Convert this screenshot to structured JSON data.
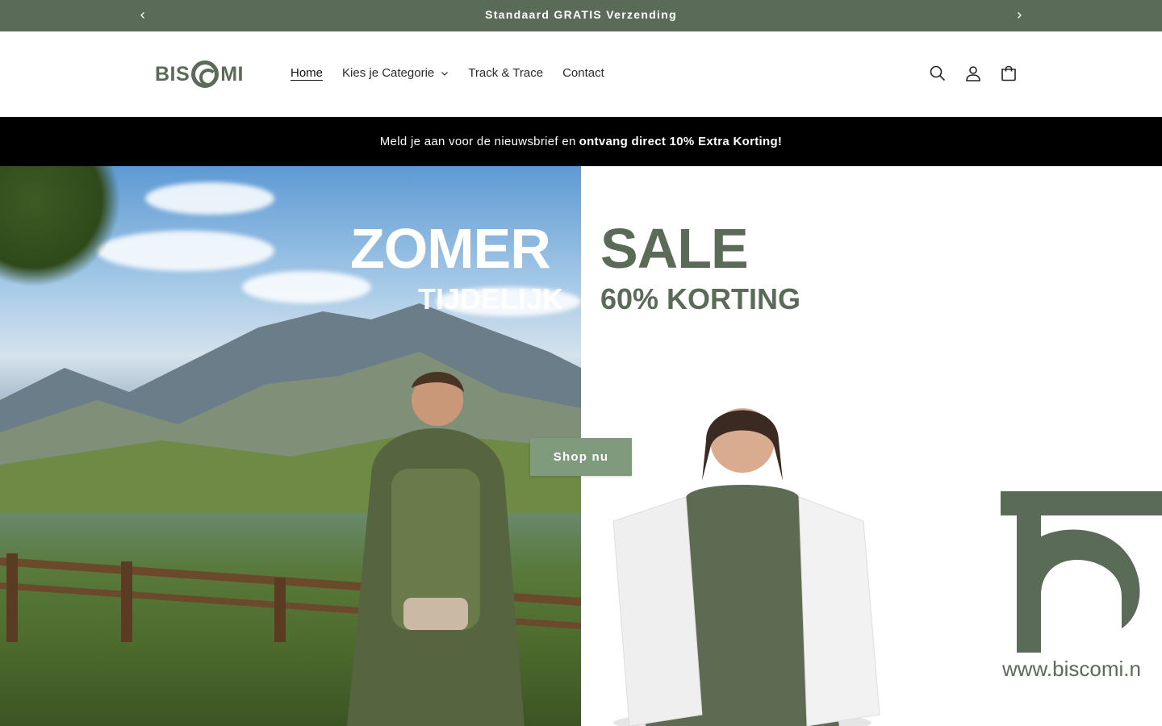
{
  "announcement": {
    "text": "Standaard GRATIS Verzending",
    "prev_icon": "chevron-left-icon",
    "next_icon": "chevron-right-icon"
  },
  "header": {
    "logo_left": "BIS",
    "logo_right": "MI",
    "nav": [
      {
        "label": "Home",
        "active": true
      },
      {
        "label": "Kies je Categorie",
        "has_dropdown": true
      },
      {
        "label": "Track & Trace"
      },
      {
        "label": "Contact"
      }
    ],
    "icons": [
      "search-icon",
      "account-icon",
      "cart-icon"
    ]
  },
  "promo": {
    "text": "Meld je aan voor de nieuwsbrief en",
    "bold": "ontvang direct 10% Extra Korting!"
  },
  "hero": {
    "headline_left": "ZOMER",
    "sub_left": "TIJDELIJK",
    "headline_right": "SALE",
    "sub_right": "60% KORTING",
    "url": "www.biscomi.n",
    "cta": "Shop nu"
  },
  "colors": {
    "brand_green": "#5a6b58",
    "button_green": "#7f9a7c",
    "promo_bg": "#000000"
  }
}
